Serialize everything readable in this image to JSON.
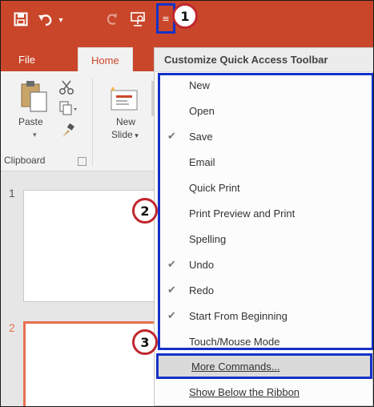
{
  "ribbon": {
    "tabs": [
      {
        "label": "File"
      },
      {
        "label": "Home"
      }
    ],
    "paste_label": "Paste",
    "new_slide_line1": "New",
    "new_slide_line2": "Slide",
    "clipboard_group_label": "Clipboard"
  },
  "slides": [
    {
      "number": "1",
      "selected": false
    },
    {
      "number": "2",
      "selected": true
    }
  ],
  "callouts": [
    "1",
    "2",
    "3"
  ],
  "menu": {
    "title": "Customize Quick Access Toolbar",
    "items": [
      {
        "label": "New",
        "checked": false
      },
      {
        "label": "Open",
        "checked": false
      },
      {
        "label": "Save",
        "checked": true
      },
      {
        "label": "Email",
        "checked": false
      },
      {
        "label": "Quick Print",
        "checked": false
      },
      {
        "label": "Print Preview and Print",
        "checked": false
      },
      {
        "label": "Spelling",
        "checked": false
      },
      {
        "label": "Undo",
        "checked": true
      },
      {
        "label": "Redo",
        "checked": true
      },
      {
        "label": "Start From Beginning",
        "checked": true
      },
      {
        "label": "Touch/Mouse Mode",
        "checked": false
      }
    ],
    "more_commands": "More Commands...",
    "show_below": "Show Below the Ribbon"
  },
  "colors": {
    "accent": "#c9462a",
    "highlight_box": "#1432c8",
    "callout_ring": "#c0272d",
    "selected_slide_border": "#e8704f"
  },
  "icons": [
    "save-icon",
    "undo-icon",
    "redo-icon",
    "start-from-beginning-icon",
    "customize-dropdown-icon",
    "paste-icon",
    "cut-icon",
    "copy-icon",
    "format-painter-icon",
    "new-slide-icon",
    "dialog-launcher-icon",
    "checkmark-icon"
  ]
}
